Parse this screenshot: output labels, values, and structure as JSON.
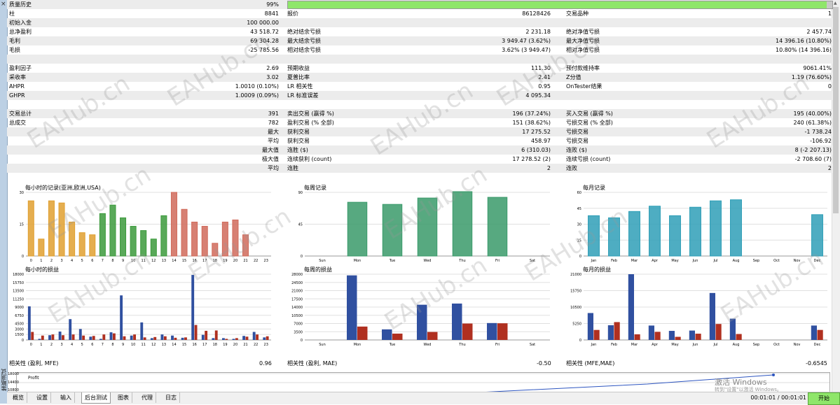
{
  "stats_rows": [
    {
      "l1": "质量历史",
      "v1": "99%",
      "quality": 0.99
    },
    {
      "l1": "柱",
      "v1": "8841",
      "l2": "报价",
      "v2": "86128426",
      "l3": "交易品种",
      "v3": "1"
    },
    {
      "l1": "初始入金",
      "v1": "100 000.00"
    },
    {
      "l1": "总净盈利",
      "v1": "43 518.72",
      "l2": "绝对结余亏损",
      "v2": "2 231.18",
      "l3": "绝对净值亏损",
      "v3": "2 457.74"
    },
    {
      "l1": "毛利",
      "v1": "69 304.28",
      "l2": "最大结余亏损",
      "v2": "3 949.47 (3.62%)",
      "l3": "最大净值亏损",
      "v3": "14 396.16 (10.80%)"
    },
    {
      "l1": "毛损",
      "v1": "-25 785.56",
      "l2": "相对结余亏损",
      "v2": "3.62% (3 949.47)",
      "l3": "相对净值亏损",
      "v3": "10.80% (14 396.16)"
    },
    {},
    {
      "l1": "盈利因子",
      "v1": "2.69",
      "l2": "预期收益",
      "v2": "111.30",
      "l3": "预付款维持率",
      "v3": "9061.41%"
    },
    {
      "l1": "采收率",
      "v1": "3.02",
      "l2": "夏普比率",
      "v2": "2.41",
      "l3": "Z分值",
      "v3": "1.19 (76.60%)"
    },
    {
      "l1": "AHPR",
      "v1": "1.0010 (0.10%)",
      "l2": "LR 相关性",
      "v2": "0.95",
      "l3": "OnTester结果",
      "v3": "0"
    },
    {
      "l1": "GHPR",
      "v1": "1.0009 (0.09%)",
      "l2": "LR 标准误差",
      "v2": "4 095.34"
    },
    {},
    {
      "l1": "交易总计",
      "v1": "391",
      "l2": "卖出交易 (赢得 %)",
      "v2": "196 (37.24%)",
      "l3": "买入交易 (赢得 %)",
      "v3": "195 (40.00%)"
    },
    {
      "l1": "总成交",
      "v1": "782",
      "l2": "盈利交易 (% 全部)",
      "v2": "151 (38.62%)",
      "l3": "亏损交易 (% 全部)",
      "v3": "240 (61.38%)"
    },
    {
      "v1": "最大",
      "l2": "获利交易",
      "v2": "17 275.52",
      "l3": "亏损交易",
      "v3": "-1 738.24"
    },
    {
      "v1": "平均",
      "l2": "获利交易",
      "v2": "458.97",
      "l3": "亏损交易",
      "v3": "-106.92"
    },
    {
      "v1": "最大值",
      "l2": "连胜 ($)",
      "v2": "6 (310.03)",
      "l3": "连败 ($)",
      "v3": "8 (-2 207.13)"
    },
    {
      "v1": "极大值",
      "l2": "连续获利 (count)",
      "v2": "17 278.52 (2)",
      "l3": "连续亏损 (count)",
      "v3": "-2 708.60 (7)"
    },
    {
      "v1": "平均",
      "l2": "连胜",
      "v2": "2",
      "l3": "连败",
      "v3": "2"
    }
  ],
  "chart_data": [
    {
      "type": "bar",
      "title": "每小时的记录(亚洲,欧洲,USA)",
      "categories": [
        "0",
        "1",
        "2",
        "3",
        "4",
        "5",
        "6",
        "7",
        "8",
        "9",
        "10",
        "11",
        "12",
        "13",
        "14",
        "15",
        "16",
        "17",
        "18",
        "19",
        "20",
        "21",
        "22",
        "23"
      ],
      "values": [
        26,
        8,
        26,
        25,
        16,
        11,
        10,
        20,
        24,
        18,
        14,
        12,
        8,
        19,
        30,
        22,
        16,
        14,
        6,
        16,
        17,
        10,
        0,
        0
      ],
      "yticks": [
        "0",
        "15",
        "30"
      ],
      "ylim": [
        0,
        30
      ],
      "colors": [
        "#e0a030",
        "#e0a030",
        "#e0a030",
        "#e0a030",
        "#e0a030",
        "#e0a030",
        "#e0a030",
        "#3c9a3c",
        "#3c9a3c",
        "#3c9a3c",
        "#3c9a3c",
        "#3c9a3c",
        "#3c9a3c",
        "#3c9a3c",
        "#d06a5a",
        "#d06a5a",
        "#d06a5a",
        "#d06a5a",
        "#d06a5a",
        "#d06a5a",
        "#d06a5a",
        "#d06a5a",
        "#d06a5a",
        "#d06a5a"
      ]
    },
    {
      "type": "bar",
      "title": "每周记录",
      "categories": [
        "Sun",
        "Mon",
        "Tue",
        "Wed",
        "Thu",
        "Fri",
        "Sat"
      ],
      "values": [
        0,
        76,
        73,
        82,
        91,
        83,
        0
      ],
      "yticks": [
        "0",
        "45",
        "90"
      ],
      "ylim": [
        0,
        90
      ],
      "colors": [
        "#3a9a6a"
      ]
    },
    {
      "type": "bar",
      "title": "每月记录",
      "categories": [
        "Jan",
        "Feb",
        "Mar",
        "Apr",
        "May",
        "Jun",
        "Jul",
        "Aug",
        "Sep",
        "Oct",
        "Nov",
        "Dec"
      ],
      "values": [
        38,
        36,
        42,
        47,
        38,
        46,
        52,
        53,
        0,
        0,
        0,
        39
      ],
      "yticks": [
        "0",
        "15",
        "30",
        "45",
        "60"
      ],
      "ylim": [
        0,
        60
      ],
      "colors": [
        "#2f9fb7"
      ]
    },
    {
      "type": "bar",
      "title": "每小时的损益",
      "categories": [
        "0",
        "1",
        "2",
        "3",
        "4",
        "5",
        "6",
        "7",
        "8",
        "9",
        "10",
        "11",
        "12",
        "13",
        "14",
        "15",
        "16",
        "17",
        "18",
        "19",
        "20",
        "21",
        "22",
        "23"
      ],
      "series": [
        {
          "name": "",
          "values": [
            9200,
            300,
            1300,
            2300,
            5700,
            3000,
            900,
            300,
            2100,
            12200,
            1200,
            4800,
            500,
            1500,
            1200,
            600,
            17800,
            1400,
            500,
            500,
            300,
            1100,
            2200,
            700
          ]
        },
        {
          "name": "",
          "values": [
            2200,
            1200,
            1500,
            1300,
            1500,
            1200,
            1100,
            1500,
            1800,
            1000,
            1500,
            700,
            800,
            1000,
            600,
            700,
            4100,
            2500,
            2600,
            300,
            500,
            900,
            1500,
            1000
          ]
        }
      ],
      "yticks": [
        "0",
        "1500",
        "3000",
        "4500",
        "6750",
        "9000",
        "11250",
        "13500",
        "15750",
        "18000"
      ],
      "ylim": [
        0,
        18000
      ],
      "colors": [
        "#3050a0",
        "#b03020"
      ]
    },
    {
      "type": "bar",
      "title": "每周的损益",
      "categories": [
        "Sun",
        "Mon",
        "Tue",
        "Wed",
        "Thu",
        "Fri",
        "Sat"
      ],
      "series": [
        {
          "name": "",
          "values": [
            0,
            27500,
            4500,
            15000,
            15500,
            7200,
            0
          ]
        },
        {
          "name": "",
          "values": [
            0,
            5700,
            2700,
            3400,
            7000,
            7100,
            0
          ]
        }
      ],
      "yticks": [
        "0",
        "3500",
        "7000",
        "10500",
        "14000",
        "17500",
        "21000",
        "24500",
        "28000"
      ],
      "ylim": [
        0,
        28000
      ],
      "colors": [
        "#3050a0",
        "#b03020"
      ]
    },
    {
      "type": "bar",
      "title": "每月的损益",
      "categories": [
        "Jan",
        "Feb",
        "Mar",
        "Apr",
        "May",
        "Jun",
        "Jul",
        "Aug",
        "Sep",
        "Oct",
        "Nov",
        "Dec"
      ],
      "series": [
        {
          "name": "",
          "values": [
            8600,
            4700,
            21000,
            4600,
            2900,
            3000,
            15000,
            6800,
            0,
            0,
            0,
            4600
          ]
        },
        {
          "name": "",
          "values": [
            3200,
            5700,
            1800,
            2600,
            1000,
            2000,
            5100,
            1900,
            0,
            0,
            0,
            3200
          ]
        }
      ],
      "yticks": [
        "0",
        "5250",
        "10500",
        "15750",
        "21000"
      ],
      "ylim": [
        0,
        21000
      ],
      "colors": [
        "#3050a0",
        "#b03020"
      ]
    }
  ],
  "correlation": [
    {
      "label": "相关性 (盈利, MFE)",
      "value": "0.96"
    },
    {
      "label": "相关性 (盈利, MAE)",
      "value": "-0.50"
    },
    {
      "label": "相关性 (MFE,MAE)",
      "value": "-0.6545"
    }
  ],
  "balance_chart": {
    "label": "Profit",
    "yticks": [
      "18000",
      "14400",
      "10800"
    ]
  },
  "tabs": [
    "概览",
    "设置",
    "输入",
    "后台测试",
    "图表",
    "代理",
    "日志"
  ],
  "active_tab": 3,
  "time_display": "00:01:01 / 00:01:01",
  "start_button": "开始",
  "panel_title": "策略测试",
  "close_icon_char": "×",
  "watermark": "EAHub.cn",
  "activation_text": "激活 Windows",
  "activation_sub": "转到\"设置\"以激活 Windows。"
}
